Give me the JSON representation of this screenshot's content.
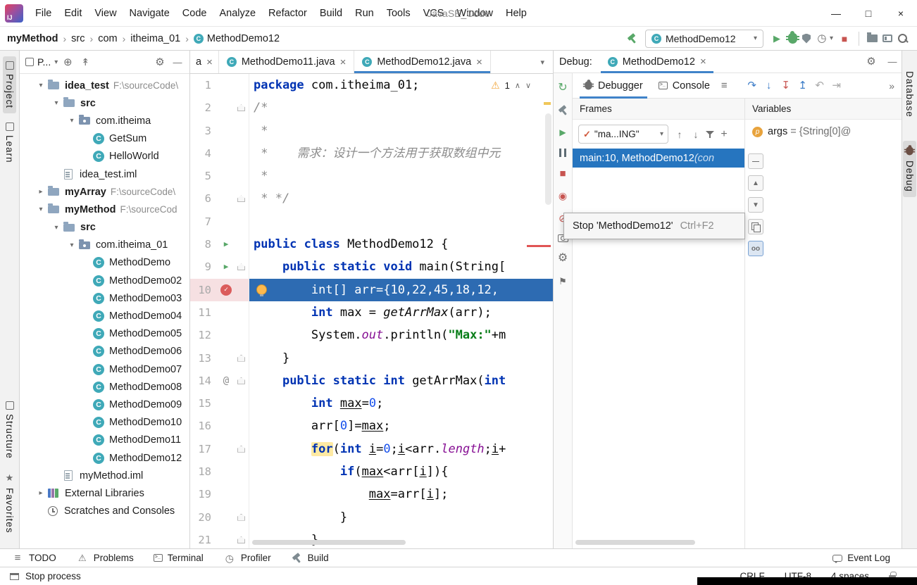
{
  "colors": {
    "accent": "#4083C9",
    "exec_line": "#2D6BB2",
    "selection": "#2675BF",
    "breakpoint": "#DB5C5C",
    "run_green": "#59A869",
    "stop_red": "#C75450",
    "keyword": "#0033B3",
    "string": "#067D17",
    "number": "#1750EB",
    "comment": "#8C8C8C"
  },
  "titlebar": {
    "logo": "IJ",
    "menus": [
      "File",
      "Edit",
      "View",
      "Navigate",
      "Code",
      "Analyze",
      "Refactor",
      "Build",
      "Run",
      "Tools",
      "VCS",
      "Window",
      "Help"
    ],
    "title": "JavaSE_Code",
    "window_controls": [
      {
        "name": "minimize-button",
        "glyph": "—"
      },
      {
        "name": "maximize-button",
        "glyph": "□"
      },
      {
        "name": "close-button",
        "glyph": "×"
      }
    ]
  },
  "navbar": {
    "breadcrumbs": [
      {
        "label": "myMethod",
        "bold": true
      },
      {
        "label": "src"
      },
      {
        "label": "com"
      },
      {
        "label": "itheima_01"
      },
      {
        "label": "MethodDemo12",
        "icon": "class"
      }
    ],
    "run_config": "MethodDemo12",
    "right_icons": [
      {
        "name": "run-icon",
        "glyph": "▶",
        "color": "#59A869",
        "size": 13
      },
      {
        "name": "debug-icon",
        "css": "bug",
        "color": "#59A869"
      },
      {
        "name": "coverage-icon",
        "css": "shield"
      },
      {
        "name": "profiler-icon",
        "glyph": "◷",
        "color": "#6E6E6E",
        "size": 15,
        "dropdown": true
      },
      {
        "name": "stop-icon",
        "glyph": "■",
        "color": "#C75450",
        "size": 14
      },
      {
        "divider": true
      },
      {
        "name": "toolwindows-icon",
        "css": "folder"
      },
      {
        "name": "layout-icon",
        "css": "layout"
      },
      {
        "name": "search-everywhere-icon",
        "css": "search"
      }
    ]
  },
  "left_strip": {
    "top": [
      {
        "label": "Project",
        "icon": "box",
        "active": true
      },
      {
        "label": "Learn",
        "icon": "box"
      }
    ],
    "bottom": [
      {
        "label": "Structure",
        "icon": "box"
      },
      {
        "label": "Favorites",
        "icon": "star"
      }
    ]
  },
  "right_strip": [
    {
      "label": "Database"
    },
    {
      "label": "Debug",
      "icon": "bug",
      "active": true
    }
  ],
  "project": {
    "toolbar": {
      "label": "P...",
      "icons": [
        {
          "name": "locate-icon",
          "glyph": "⊕",
          "color": "#6E6E6E",
          "size": 15
        },
        {
          "name": "collapse-all-icon",
          "glyph": "↟",
          "color": "#6E6E6E",
          "size": 14
        },
        {
          "gap": true
        },
        {
          "name": "settings-gear-icon",
          "glyph": "⚙",
          "color": "#6E6E6E",
          "size": 15
        },
        {
          "name": "hide-panel-icon",
          "glyph": "—",
          "color": "#6E6E6E",
          "size": 13
        }
      ]
    },
    "tree": [
      {
        "ind": 1,
        "chev": "open",
        "icon": "folder",
        "label": "idea_test",
        "path": "F:\\sourceCode\\",
        "bold": true
      },
      {
        "ind": 2,
        "chev": "open",
        "icon": "folder",
        "label": "src",
        "bold": true
      },
      {
        "ind": 3,
        "chev": "open",
        "icon": "package",
        "label": "com.itheima"
      },
      {
        "ind": 4,
        "icon": "class",
        "label": "GetSum"
      },
      {
        "ind": 4,
        "icon": "class",
        "label": "HelloWorld"
      },
      {
        "ind": 2,
        "icon": "file",
        "label": "idea_test.iml"
      },
      {
        "ind": 1,
        "chev": "closed",
        "icon": "folder",
        "label": "myArray",
        "path": "F:\\sourceCode\\",
        "bold": true
      },
      {
        "ind": 1,
        "chev": "open",
        "icon": "folder",
        "label": "myMethod",
        "path": "F:\\sourceCod",
        "bold": true
      },
      {
        "ind": 2,
        "chev": "open",
        "icon": "folder",
        "label": "src",
        "bold": true
      },
      {
        "ind": 3,
        "chev": "open",
        "icon": "package",
        "label": "com.itheima_01"
      },
      {
        "ind": 4,
        "icon": "class",
        "label": "MethodDemo"
      },
      {
        "ind": 4,
        "icon": "class",
        "label": "MethodDemo02"
      },
      {
        "ind": 4,
        "icon": "class",
        "label": "MethodDemo03"
      },
      {
        "ind": 4,
        "icon": "class",
        "label": "MethodDemo04"
      },
      {
        "ind": 4,
        "icon": "class",
        "label": "MethodDemo05"
      },
      {
        "ind": 4,
        "icon": "class",
        "label": "MethodDemo06"
      },
      {
        "ind": 4,
        "icon": "class",
        "label": "MethodDemo07"
      },
      {
        "ind": 4,
        "icon": "class",
        "label": "MethodDemo08"
      },
      {
        "ind": 4,
        "icon": "class",
        "label": "MethodDemo09"
      },
      {
        "ind": 4,
        "icon": "class",
        "label": "MethodDemo10"
      },
      {
        "ind": 4,
        "icon": "class",
        "label": "MethodDemo11"
      },
      {
        "ind": 4,
        "icon": "class",
        "label": "MethodDemo12"
      },
      {
        "ind": 2,
        "icon": "file",
        "label": "myMethod.iml"
      },
      {
        "ind": 1,
        "chev": "closed",
        "icon": "lib",
        "label": "External Libraries"
      },
      {
        "ind": 1,
        "icon": "scratch",
        "label": "Scratches and Consoles"
      }
    ]
  },
  "editor": {
    "partial_tab": "a",
    "close_glyph": "×",
    "tabs": [
      {
        "label": "MethodDemo11.java"
      },
      {
        "label": "MethodDemo12.java",
        "selected": true
      }
    ],
    "warning_count": "1",
    "lines": [
      {
        "n": 1,
        "tokens": [
          [
            "kw",
            "package "
          ],
          [
            "pl",
            "com.itheima_01;"
          ]
        ]
      },
      {
        "n": 2,
        "fold": true,
        "tokens": [
          [
            "cmt",
            "/*"
          ]
        ]
      },
      {
        "n": 3,
        "tokens": [
          [
            "cmt",
            " *"
          ]
        ]
      },
      {
        "n": 4,
        "tokens": [
          [
            "cmt",
            " *    需求：设计一个方法用于获取数组中元"
          ]
        ]
      },
      {
        "n": 5,
        "tokens": [
          [
            "cmt",
            " *"
          ]
        ]
      },
      {
        "n": 6,
        "fold": true,
        "tokens": [
          [
            "cmt",
            " * */"
          ]
        ]
      },
      {
        "n": 7,
        "tokens": []
      },
      {
        "n": 8,
        "run": true,
        "tokens": [
          [
            "kw",
            "public class "
          ],
          [
            "pl",
            "MethodDemo12 {"
          ]
        ]
      },
      {
        "n": 9,
        "run": true,
        "fold": true,
        "tokens": [
          [
            "pl",
            "    "
          ],
          [
            "kw",
            "public static void "
          ],
          [
            "pl",
            "main(String["
          ]
        ]
      },
      {
        "n": 10,
        "bp": true,
        "exec": true,
        "bulb": true,
        "tokens": [
          [
            "pl",
            "        int[] arr={10,22,45,18,12,"
          ]
        ]
      },
      {
        "n": 11,
        "tokens": [
          [
            "pl",
            "        "
          ],
          [
            "kw",
            "int "
          ],
          [
            "pl",
            "max = "
          ],
          [
            "itl",
            "getArrMax"
          ],
          [
            "pl",
            "(arr);"
          ]
        ]
      },
      {
        "n": 12,
        "tokens": [
          [
            "pl",
            "        System."
          ],
          [
            "fld",
            "out"
          ],
          [
            "pl",
            ".println("
          ],
          [
            "str",
            "\"Max:\""
          ],
          [
            "pl",
            "+m"
          ]
        ]
      },
      {
        "n": 13,
        "fold": true,
        "tokens": [
          [
            "pl",
            "    }"
          ]
        ]
      },
      {
        "n": 14,
        "at": true,
        "fold": true,
        "tokens": [
          [
            "pl",
            "    "
          ],
          [
            "kw",
            "public static int "
          ],
          [
            "pl",
            "getArrMax("
          ],
          [
            "kw",
            "int"
          ]
        ]
      },
      {
        "n": 15,
        "tokens": [
          [
            "pl",
            "        "
          ],
          [
            "kw",
            "int "
          ],
          [
            "und",
            "max"
          ],
          [
            "pl",
            "="
          ],
          [
            "num",
            "0"
          ],
          [
            "pl",
            ";"
          ]
        ]
      },
      {
        "n": 16,
        "tokens": [
          [
            "pl",
            "        arr["
          ],
          [
            "num",
            "0"
          ],
          [
            "pl",
            "]="
          ],
          [
            "und",
            "max"
          ],
          [
            "pl",
            ";"
          ]
        ]
      },
      {
        "n": 17,
        "fold": true,
        "tokens": [
          [
            "pl",
            "        "
          ],
          [
            "kwh",
            "for"
          ],
          [
            "pl",
            "("
          ],
          [
            "kw",
            "int "
          ],
          [
            "und",
            "i"
          ],
          [
            "pl",
            "="
          ],
          [
            "num",
            "0"
          ],
          [
            "pl",
            ";"
          ],
          [
            "und",
            "i"
          ],
          [
            "pl",
            "<arr."
          ],
          [
            "fld",
            "length"
          ],
          [
            "pl",
            ";"
          ],
          [
            "und",
            "i"
          ],
          [
            "pl",
            "+"
          ]
        ]
      },
      {
        "n": 18,
        "tokens": [
          [
            "pl",
            "            "
          ],
          [
            "kw",
            "if"
          ],
          [
            "pl",
            "("
          ],
          [
            "und",
            "max"
          ],
          [
            "pl",
            "<arr["
          ],
          [
            "und",
            "i"
          ],
          [
            "pl",
            "]){"
          ]
        ]
      },
      {
        "n": 19,
        "tokens": [
          [
            "pl",
            "                "
          ],
          [
            "und",
            "max"
          ],
          [
            "pl",
            "=arr["
          ],
          [
            "und",
            "i"
          ],
          [
            "pl",
            "];"
          ]
        ]
      },
      {
        "n": 20,
        "fold": true,
        "tokens": [
          [
            "pl",
            "            }"
          ]
        ]
      },
      {
        "n": 21,
        "fold": true,
        "tokens": [
          [
            "pl",
            "        }"
          ]
        ]
      }
    ]
  },
  "debug": {
    "label": "Debug:",
    "tab": "MethodDemo12",
    "close_glyph": "×",
    "header_icons": [
      {
        "name": "settings-gear-icon",
        "glyph": "⚙",
        "color": "#6E6E6E",
        "size": 15
      },
      {
        "name": "hide-panel-icon",
        "glyph": "—",
        "color": "#6E6E6E",
        "size": 13
      }
    ],
    "view_tabs": [
      "Debugger",
      "Console"
    ],
    "menu_glyph": "≡",
    "more_glyph": "»",
    "left_toolbar": [
      {
        "name": "rerun-icon",
        "glyph": "↻",
        "color": "#59A869",
        "size": 16
      },
      {
        "name": "build-settings-icon",
        "css": "hammer",
        "color": "#7F8B91"
      },
      {
        "name": "resume-icon",
        "glyph": "▶",
        "color": "#59A869",
        "size": 12
      },
      {
        "name": "pause-icon",
        "css": "pause"
      },
      {
        "name": "stop-icon",
        "glyph": "■",
        "color": "#C75450",
        "size": 15
      },
      {
        "name": "view-breakpoints-icon",
        "glyph": "◉",
        "color": "#C75450",
        "size": 14
      },
      {
        "name": "mute-breakpoints-icon",
        "glyph": "⊘",
        "color": "#C75450",
        "size": 14
      },
      {
        "name": "thread-dump-icon",
        "css": "camera"
      },
      {
        "name": "debug-settings-icon",
        "glyph": "⚙",
        "color": "#6E6E6E",
        "size": 16
      },
      {
        "name": "pin-icon",
        "glyph": "⚑",
        "color": "#6E6E6E",
        "size": 13
      }
    ],
    "step_icons": [
      {
        "name": "step-over-icon",
        "glyph": "↷",
        "color": "#3D7DC8",
        "size": 15
      },
      {
        "name": "step-into-icon",
        "glyph": "↓",
        "color": "#3D7DC8",
        "size": 15
      },
      {
        "name": "force-step-into-icon",
        "glyph": "↧",
        "color": "#C75450",
        "size": 15
      },
      {
        "name": "step-out-icon",
        "glyph": "↥",
        "color": "#3D7DC8",
        "size": 15
      },
      {
        "name": "drop-frame-icon",
        "glyph": "↶",
        "color": "#A9A9A9",
        "size": 15
      },
      {
        "name": "run-to-cursor-icon",
        "glyph": "⇥",
        "color": "#A9A9A9",
        "size": 15
      }
    ],
    "frames": {
      "title": "Frames",
      "thread": "\"ma...ING\"",
      "toolbar": [
        {
          "name": "prev-frame-icon",
          "glyph": "↑",
          "color": "#6E6E6E",
          "size": 14
        },
        {
          "name": "next-frame-icon",
          "glyph": "↓",
          "color": "#6E6E6E",
          "size": 14
        },
        {
          "name": "filter-icon",
          "css": "funnel"
        },
        {
          "name": "add-watch-icon",
          "glyph": "+",
          "color": "#6E6E6E",
          "size": 16
        }
      ],
      "selected_frame": "main:10, MethodDemo12 ",
      "selected_frame_suffix": "(con"
    },
    "variables": {
      "title": "Variables",
      "row": {
        "icon": "p",
        "name": "args",
        "value": " = {String[0]@"
      }
    },
    "side_buttons": [
      {
        "name": "collapse-button",
        "glyph": "—"
      },
      {
        "name": "scroll-up-button",
        "glyph": "▲"
      },
      {
        "name": "scroll-down-button",
        "glyph": "▼"
      },
      {
        "name": "copy-button",
        "css": "copy"
      },
      {
        "name": "watch-button",
        "glyph": "oo",
        "sel": true
      }
    ],
    "tooltip": {
      "text": "Stop 'MethodDemo12'",
      "shortcut": "Ctrl+F2"
    }
  },
  "bottom_bar": {
    "items": [
      {
        "label": "TODO",
        "icon": "todo"
      },
      {
        "label": "Problems",
        "icon": "problems"
      },
      {
        "label": "Terminal",
        "icon": "terminal"
      },
      {
        "label": "Profiler",
        "icon": "profiler"
      },
      {
        "label": "Build",
        "icon": "build"
      }
    ],
    "event_log": "Event Log"
  },
  "status_bar": {
    "left": "Stop process",
    "right": [
      "CRLF",
      "UTF-8",
      "4 spaces"
    ]
  }
}
